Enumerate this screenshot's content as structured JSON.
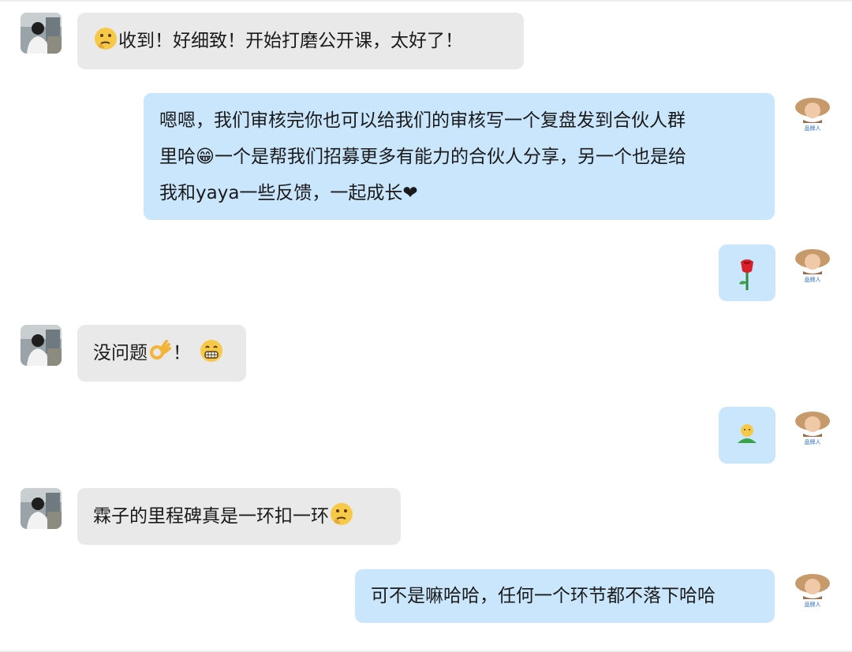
{
  "messages": [
    {
      "side": "in",
      "emoji_lead": "thinking-face",
      "text": "收到！好细致！开始打磨公开课，太好了！"
    },
    {
      "side": "out",
      "lines": [
        "嗯嗯，我们审核完你也可以给我们的审核写一个复盘发到合伙人群",
        "里哈😁一个是帮我们招募更多有能力的合伙人分享，另一个也是给",
        "我和yaya一些反馈，一起成长❤"
      ]
    },
    {
      "side": "out",
      "emoji_only": "rose"
    },
    {
      "side": "in",
      "text_a": "没问题",
      "emoji_a": "ok-hand",
      "text_b": "！",
      "emoji_b": "grinning-face"
    },
    {
      "side": "out",
      "emoji_only": "person-green"
    },
    {
      "side": "in",
      "text": "霖子的里程碑真是一环扣一环",
      "emoji_trail": "thinking-face"
    },
    {
      "side": "out",
      "text": "可不是嘛哈哈，任何一个环节都不落下哈哈"
    }
  ],
  "colors": {
    "incoming_bubble": "#e9e9e9",
    "outgoing_bubble": "#cae6fd"
  }
}
